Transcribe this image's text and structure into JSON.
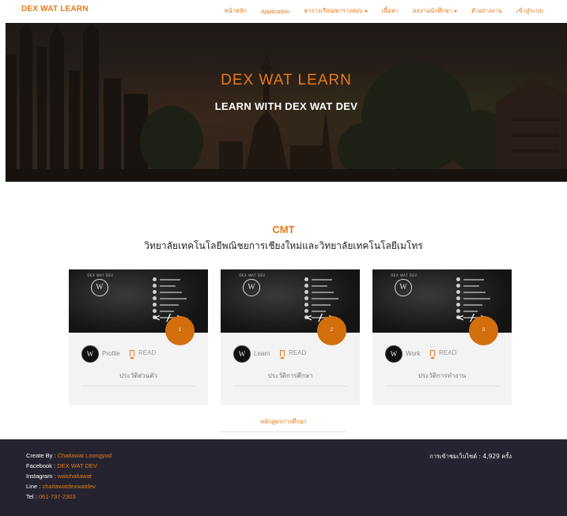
{
  "navbar": {
    "brand": "DEX WAT LEARN",
    "items": [
      {
        "label": "หน้าหลัก",
        "dropdown": false
      },
      {
        "label": "Application",
        "dropdown": false
      },
      {
        "label": "ตารางเรียน/ตารางสอบ",
        "dropdown": true
      },
      {
        "label": "เนื้อหา",
        "dropdown": false
      },
      {
        "label": "ผลงานนักศึกษา",
        "dropdown": true
      },
      {
        "label": "ตัวอย่างงาน",
        "dropdown": false
      },
      {
        "label": "เข้าสู่ระบบ",
        "dropdown": false
      }
    ]
  },
  "hero": {
    "title": "DEX WAT LEARN",
    "subtitle": "LEARN WITH DEX WAT DEV"
  },
  "section": {
    "title": "CMT",
    "subtitle": "วิทยาลัยเทคโนโลยีพณิชยการเชียงใหม่และวิทยาลัยเทคโนโลยีเมโทร"
  },
  "cards": [
    {
      "badge": "1",
      "label": "Profile",
      "read": "READ",
      "desc": "ประวัติส่วนตัว"
    },
    {
      "badge": "2",
      "label": "Learn",
      "read": "READ",
      "desc": "ประวัติการศึกษา"
    },
    {
      "badge": "3",
      "label": "Work",
      "read": "READ",
      "desc": "ประวัติการทำงาน"
    }
  ],
  "card_image": {
    "logo_letter": "W",
    "logo_caption": "DEX WAT DEV",
    "code_symbol": "< / >"
  },
  "curriculum_link": "หลักสูตรการศึกษา",
  "footer": {
    "lines": [
      {
        "key": "Create By :",
        "value": "Chaitawat Loongyod"
      },
      {
        "key": "Facebook :",
        "value": "DEX WAT DEV"
      },
      {
        "key": "Instagram :",
        "value": "watchaitawat"
      },
      {
        "key": "Line :",
        "value": "chaitawatdexwatdev"
      },
      {
        "key": "Tel :",
        "value": "061-737-2303"
      }
    ],
    "visits": "การเข้าชมเว็บไซต์ : 4,929 ครั้ง"
  },
  "colors": {
    "accent": "#e8791a",
    "badge": "#d26e0c",
    "footer_bg": "#24232f",
    "card_bg": "#f3f3f4"
  }
}
